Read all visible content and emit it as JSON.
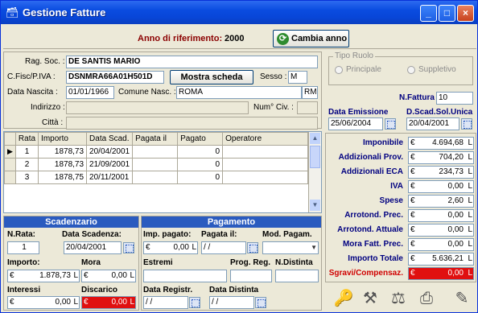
{
  "window": {
    "title": "Gestione Fatture",
    "min": "_",
    "max": "□",
    "close": "×"
  },
  "year": {
    "label": "Anno di riferimento:",
    "value": "2000",
    "change_button": "Cambia anno"
  },
  "contributor": {
    "ragsoc_label": "Rag. Soc. :",
    "ragsoc": "DE SANTIS MARIO",
    "cf_label": "C.Fisc/P.IVA :",
    "cf": "DSNMRA66A01H501D",
    "show_button": "Mostra scheda",
    "sesso_label": "Sesso :",
    "sesso": "M",
    "nascita_label": "Data Nascita :",
    "nascita": "01/01/1966",
    "comune_label": "Comune Nasc. :",
    "comune": "ROMA",
    "prov": "RM",
    "indirizzo_label": "Indirizzo :",
    "indirizzo": "",
    "civ_label": "Num° Civ. :",
    "civ": "",
    "citta_label": "Città :",
    "citta": ""
  },
  "rate_table": {
    "headers": [
      "Rata",
      "Importo",
      "Data Scad.",
      "Pagata il",
      "Pagato",
      "Operatore"
    ],
    "rows": [
      [
        "1",
        "1878,73",
        "20/04/2001",
        "",
        "0",
        ""
      ],
      [
        "2",
        "1878,73",
        "21/09/2001",
        "",
        "0",
        ""
      ],
      [
        "3",
        "1878,75",
        "20/11/2001",
        "",
        "0",
        ""
      ]
    ]
  },
  "scadenzario": {
    "title": "Scadenzario",
    "nrata_label": "N.Rata:",
    "nrata": "1",
    "data_label": "Data Scadenza:",
    "data": "20/04/2001",
    "importo_label": "Importo:",
    "importo_cur": "€",
    "importo": "1.878,73",
    "importo_unit": "L",
    "mora_label": "Mora",
    "mora_cur": "€",
    "mora": "0,00",
    "mora_unit": "L",
    "interessi_label": "Interessi",
    "interessi_cur": "€",
    "interessi": "0,00",
    "interessi_unit": "L",
    "discarico_label": "Discarico",
    "discarico_cur": "€",
    "discarico": "0,00",
    "discarico_unit": "L"
  },
  "pagamento": {
    "title": "Pagamento",
    "imp_label": "Imp. pagato:",
    "imp_cur": "€",
    "imp": "0,00",
    "imp_unit": "L",
    "pagata_label": "Pagata il:",
    "pagata": "/ /",
    "mod_label": "Mod. Pagam.",
    "mod": "",
    "estremi_label": "Estremi",
    "estremi": "",
    "progreg_label": "Prog. Reg.",
    "progreg": "",
    "ndistinta_label": "N.Distinta",
    "ndistinta": "",
    "dataregistr_label": "Data Registr.",
    "dataregistr": "/ /",
    "datadistinta_label": "Data Distinta",
    "datadistinta": "/ /"
  },
  "right": {
    "tipo_ruolo_label": "Tipo Ruolo",
    "principale": "Principale",
    "suppletivo": "Suppletivo",
    "nfattura_label": "N.Fattura",
    "nfattura": "10",
    "emissione_label": "Data Emissione",
    "emissione": "25/06/2004",
    "scadenza_label": "D.Scad.Sol.Unica",
    "scadenza": "20/04/2001"
  },
  "totals": [
    {
      "label": "Imponibile",
      "cur": "€",
      "value": "4.694,68",
      "unit": "L"
    },
    {
      "label": "Addizionali Prov.",
      "cur": "€",
      "value": "704,20",
      "unit": "L"
    },
    {
      "label": "Addizionali ECA",
      "cur": "€",
      "value": "234,73",
      "unit": "L"
    },
    {
      "label": "IVA",
      "cur": "€",
      "value": "0,00",
      "unit": "L"
    },
    {
      "label": "Spese",
      "cur": "€",
      "value": "2,60",
      "unit": "L"
    },
    {
      "label": "Arrotond. Prec.",
      "cur": "€",
      "value": "0,00",
      "unit": "L"
    },
    {
      "label": "Arrotond. Attuale",
      "cur": "€",
      "value": "0,00",
      "unit": "L"
    },
    {
      "label": "Mora Fatt. Prec.",
      "cur": "€",
      "value": "0,00",
      "unit": "L"
    },
    {
      "label": "Importo Totale",
      "cur": "€",
      "value": "5.636,21",
      "unit": "L"
    },
    {
      "label": "Sgravi/Compensaz.",
      "cur": "€",
      "value": "0,00",
      "unit": "L"
    }
  ],
  "toolbar": [
    "keys-icon",
    "tools-icon",
    "scales-icon",
    "printer-icon",
    "notepad-icon"
  ]
}
